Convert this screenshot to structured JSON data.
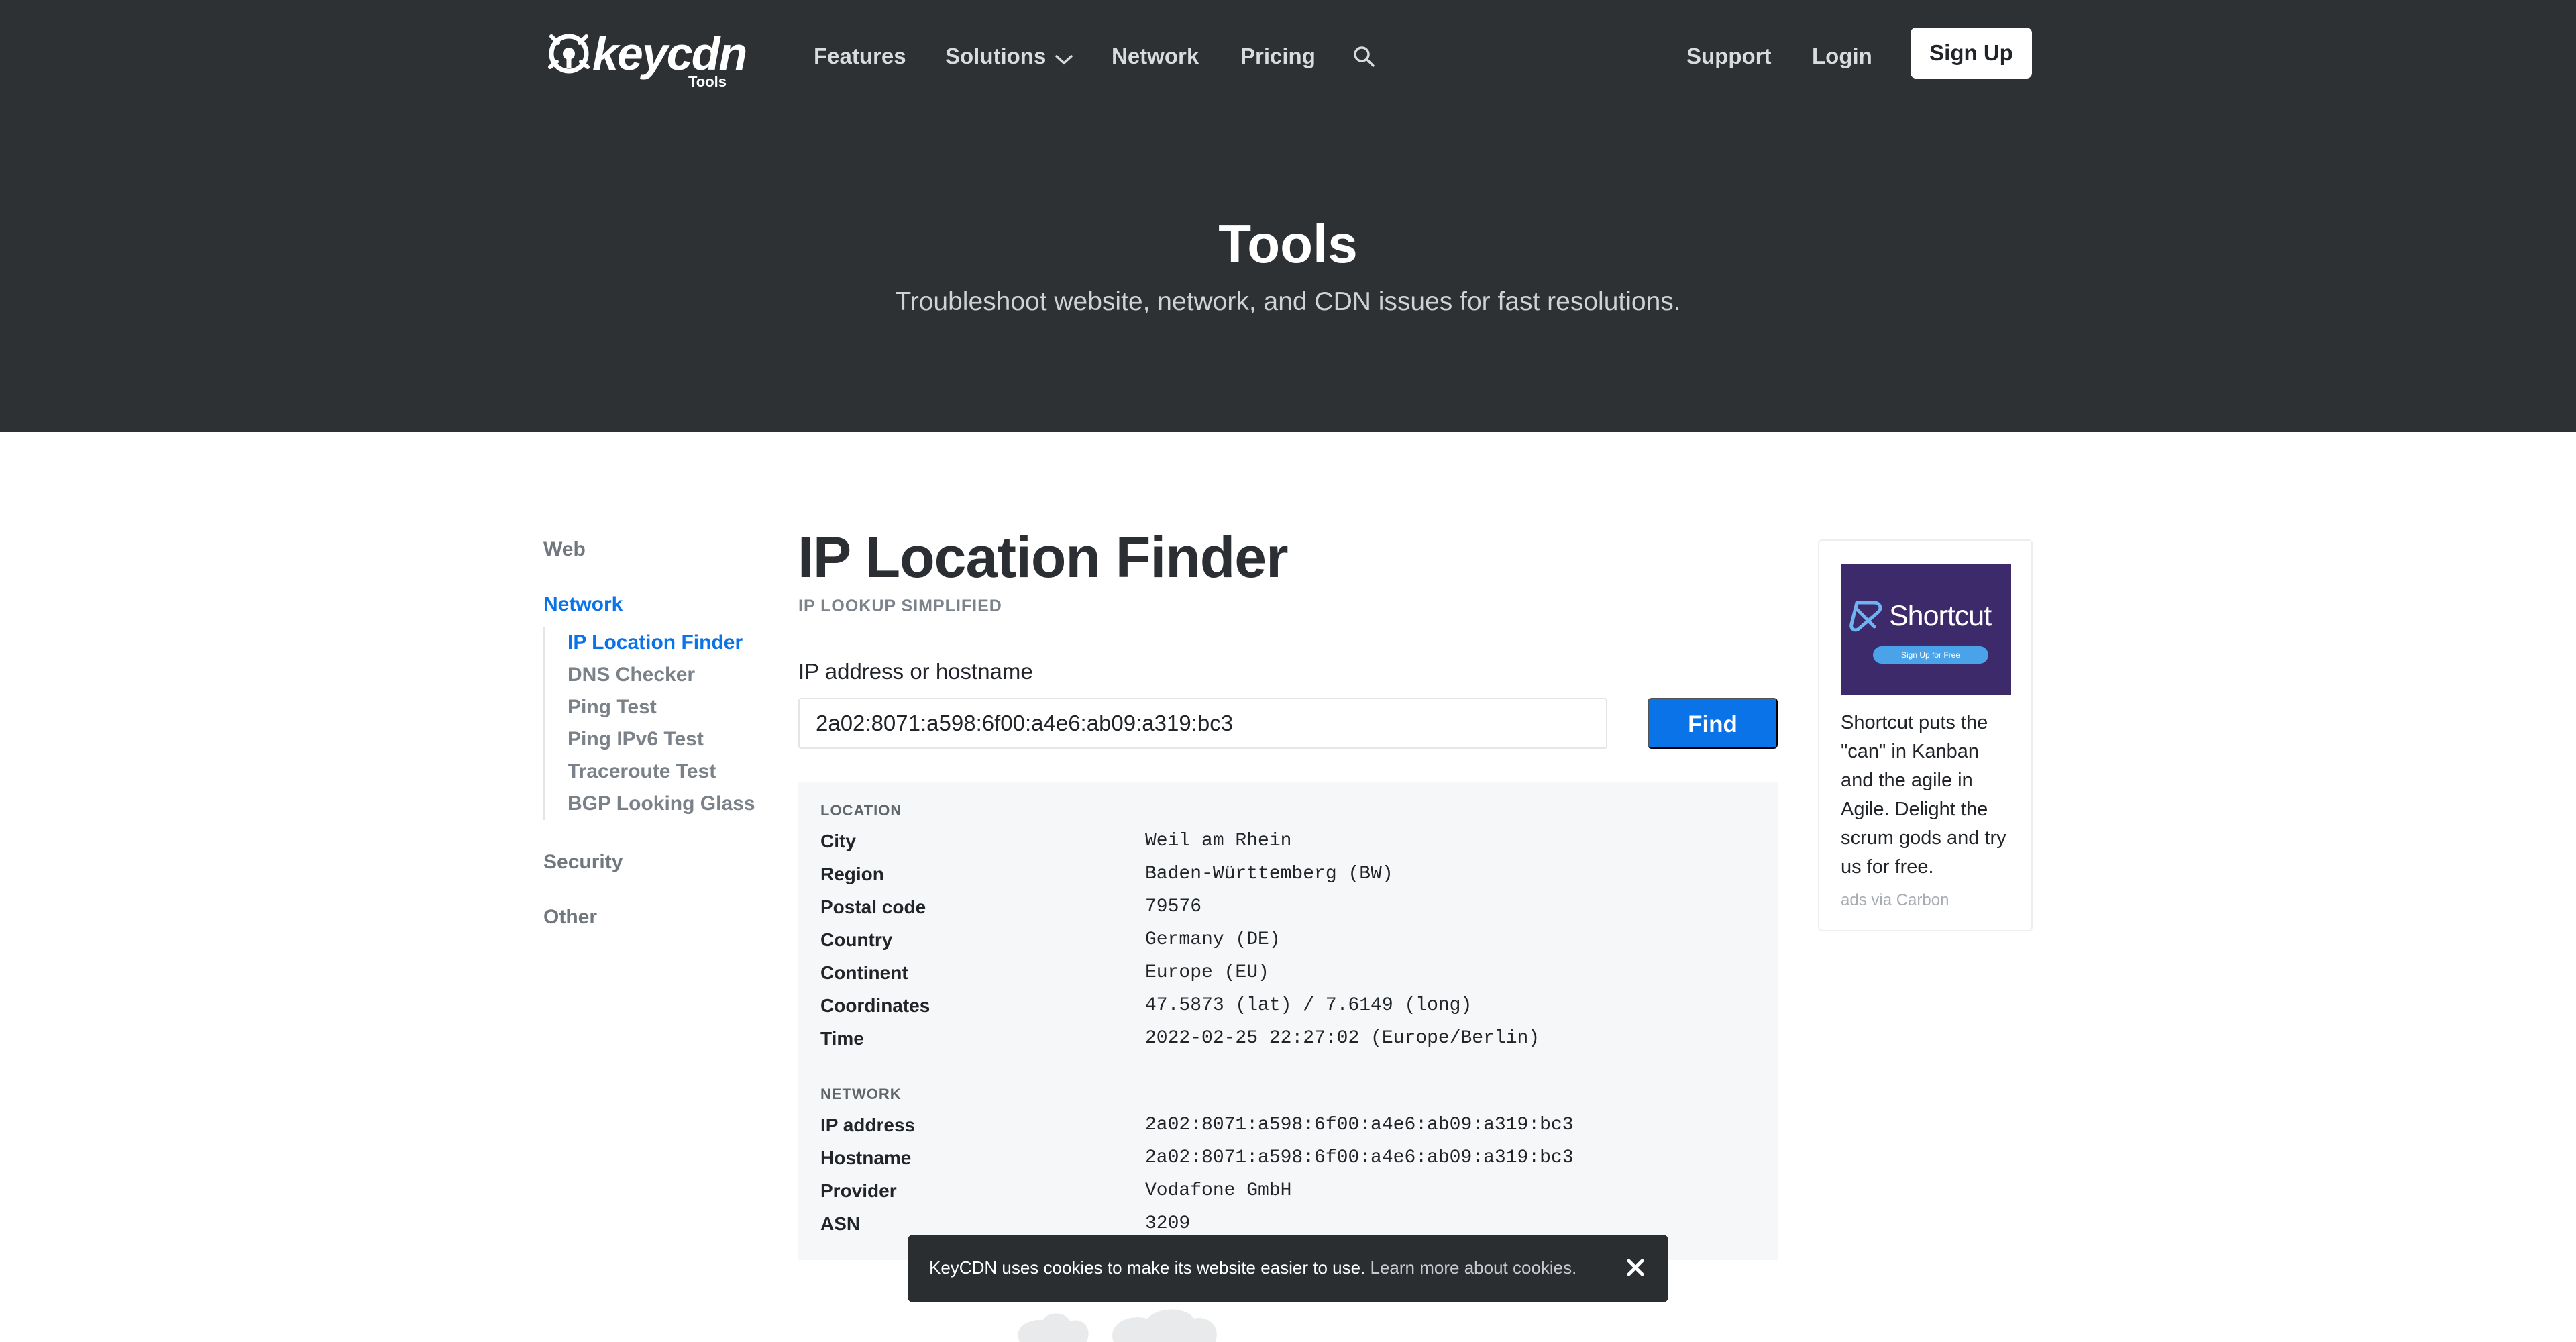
{
  "header": {
    "logo": {
      "text": "keycdn",
      "sub": "Tools",
      "icon": "keycdn-logo-icon"
    },
    "nav": {
      "features": "Features",
      "solutions": "Solutions",
      "network": "Network",
      "pricing": "Pricing",
      "support": "Support",
      "login": "Login",
      "signup": "Sign Up"
    },
    "hero_title": "Tools",
    "hero_subtitle": "Troubleshoot website, network, and CDN issues for fast resolutions."
  },
  "sidebar": {
    "web": "Web",
    "network": "Network",
    "network_items": [
      "IP Location Finder",
      "DNS Checker",
      "Ping Test",
      "Ping IPv6 Test",
      "Traceroute Test",
      "BGP Looking Glass"
    ],
    "security": "Security",
    "other": "Other"
  },
  "main": {
    "title": "IP Location Finder",
    "kicker": "IP LOOKUP SIMPLIFIED",
    "field_label": "IP address or hostname",
    "input_value": "2a02:8071:a598:6f00:a4e6:ab09:a319:bc3",
    "find_label": "Find"
  },
  "results": {
    "location_title": "LOCATION",
    "location": [
      {
        "key": "City",
        "value": "Weil am Rhein"
      },
      {
        "key": "Region",
        "value": "Baden-Württemberg (BW)"
      },
      {
        "key": "Postal code",
        "value": "79576"
      },
      {
        "key": "Country",
        "value": "Germany (DE)"
      },
      {
        "key": "Continent",
        "value": "Europe (EU)"
      },
      {
        "key": "Coordinates",
        "value": "47.5873 (lat) / 7.6149 (long)"
      },
      {
        "key": "Time",
        "value": "2022-02-25 22:27:02 (Europe/Berlin)"
      }
    ],
    "network_title": "NETWORK",
    "network": [
      {
        "key": "IP address",
        "value": "2a02:8071:a598:6f00:a4e6:ab09:a319:bc3"
      },
      {
        "key": "Hostname",
        "value": "2a02:8071:a598:6f00:a4e6:ab09:a319:bc3"
      },
      {
        "key": "Provider",
        "value": "Vodafone GmbH"
      },
      {
        "key": "ASN",
        "value": "3209"
      }
    ]
  },
  "ad": {
    "image_title": "Shortcut",
    "image_button": "Sign Up for Free",
    "text": "Shortcut puts the \"can\" in Kanban and the agile in Agile. Delight the scrum gods and try us for free.",
    "via": "ads via Carbon"
  },
  "cookie": {
    "text": "KeyCDN uses cookies to make its website easier to use.",
    "link": "Learn more about cookies."
  },
  "colors": {
    "header_bg": "#2e3134",
    "accent": "#0a73e8",
    "results_bg": "#f6f7f8",
    "ad_bg": "#3d2a6b"
  }
}
